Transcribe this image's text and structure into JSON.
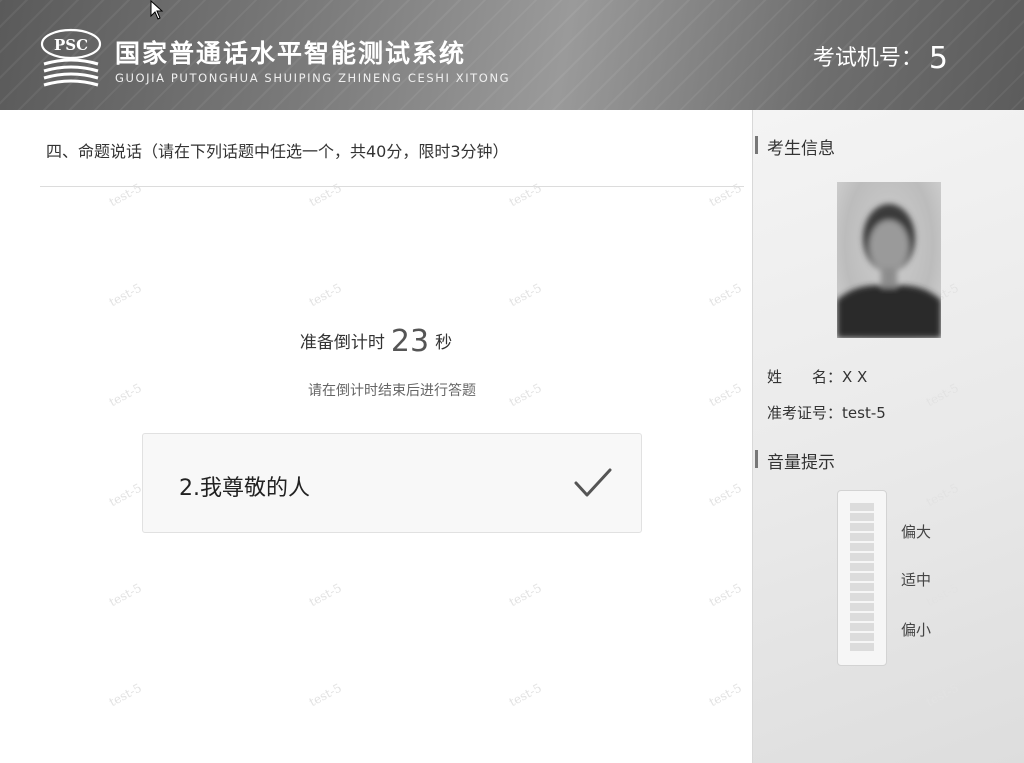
{
  "header": {
    "title_cn": "国家普通话水平智能测试系统",
    "title_en": "GUOJIA PUTONGHUA SHUIPING ZHINENG CESHI XITONG",
    "logo_text": "PSC",
    "exam_no_label": "考试机号：",
    "exam_no_value": "5"
  },
  "main": {
    "question_heading": "四、命题说话（请在下列话题中任选一个，共40分，限时3分钟）",
    "countdown_prefix": "准备倒计时",
    "countdown_seconds": "23",
    "countdown_unit": "秒",
    "hint": "请在倒计时结束后进行答题",
    "topic_label": "2.我尊敬的人",
    "watermark_text": "test-5"
  },
  "sidebar": {
    "candidate_section_title": "考生信息",
    "name_label": "姓　　名：",
    "name_value": "X X",
    "ticket_label": "准考证号：",
    "ticket_value": "test-5",
    "volume_section_title": "音量提示",
    "volume_labels": {
      "high": "偏大",
      "mid": "适中",
      "low": "偏小"
    }
  },
  "colors": {
    "header_bg": "#6e6e6e",
    "sidebar_bg": "#ececec",
    "accent": "#777777"
  }
}
